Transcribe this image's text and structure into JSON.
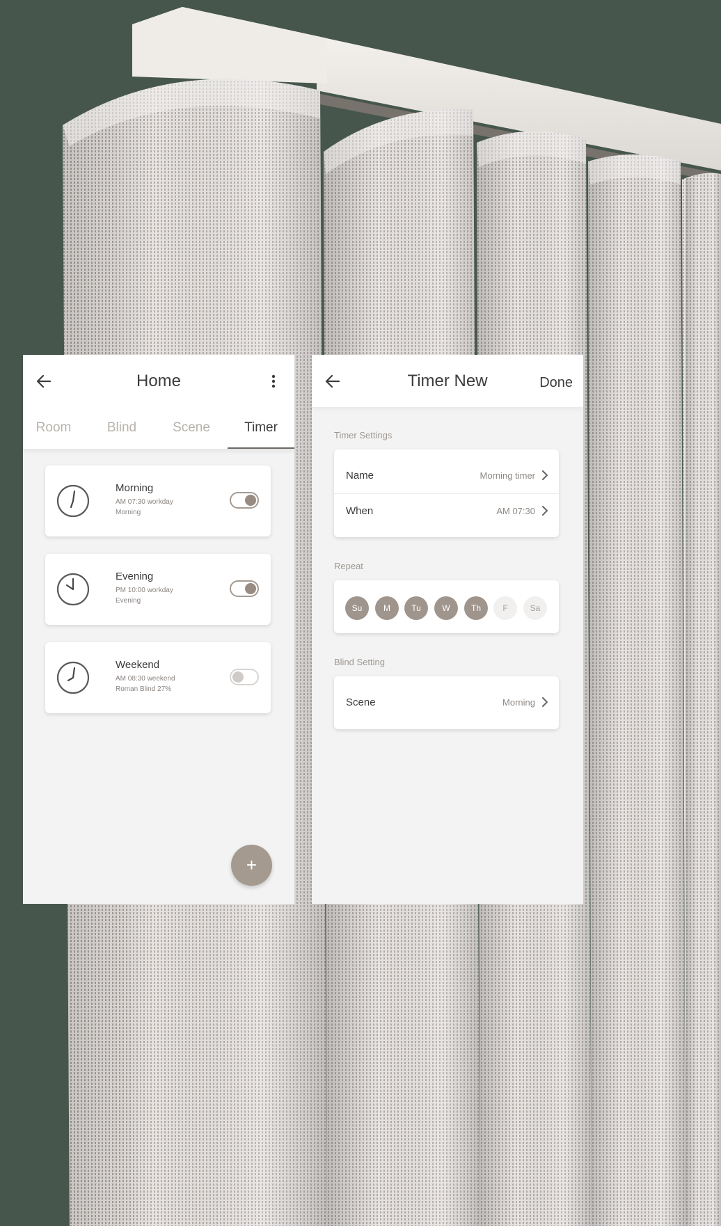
{
  "home_screen": {
    "title": "Home",
    "tabs": [
      {
        "label": "Room",
        "active": false
      },
      {
        "label": "Blind",
        "active": false
      },
      {
        "label": "Scene",
        "active": false
      },
      {
        "label": "Timer",
        "active": true
      }
    ],
    "timers": [
      {
        "name": "Morning",
        "line1": "AM 07:30 workday",
        "line2": "Morning",
        "enabled": true
      },
      {
        "name": "Evening",
        "line1": "PM 10:00 workday",
        "line2": "Evening",
        "enabled": true
      },
      {
        "name": "Weekend",
        "line1": "AM 08:30 weekend",
        "line2": "Roman Blind 27%",
        "enabled": false
      }
    ],
    "add_button": "+"
  },
  "timer_new_screen": {
    "title": "Timer New",
    "done_label": "Done",
    "timer_settings_label": "Timer Settings",
    "name_row": {
      "label": "Name",
      "value": "Morning timer"
    },
    "when_row": {
      "label": "When",
      "value": "AM 07:30"
    },
    "repeat_label": "Repeat",
    "days": [
      {
        "label": "Su",
        "selected": true
      },
      {
        "label": "M",
        "selected": true
      },
      {
        "label": "Tu",
        "selected": true
      },
      {
        "label": "W",
        "selected": true
      },
      {
        "label": "Th",
        "selected": true
      },
      {
        "label": "F",
        "selected": false
      },
      {
        "label": "Sa",
        "selected": false
      }
    ],
    "blind_setting_label": "Blind Setting",
    "scene_row": {
      "label": "Scene",
      "value": "Morning"
    }
  },
  "colors": {
    "background": "#46564c",
    "accent": "#a0958d",
    "text_primary": "#3d3d3d",
    "text_secondary": "#8f8984",
    "tab_inactive": "#b8b2ac"
  },
  "icons": {
    "back": "arrow-left-icon",
    "more": "vertical-dots-icon",
    "chevron": "chevron-right-icon",
    "clock": "clock-icon",
    "add": "plus-icon"
  }
}
